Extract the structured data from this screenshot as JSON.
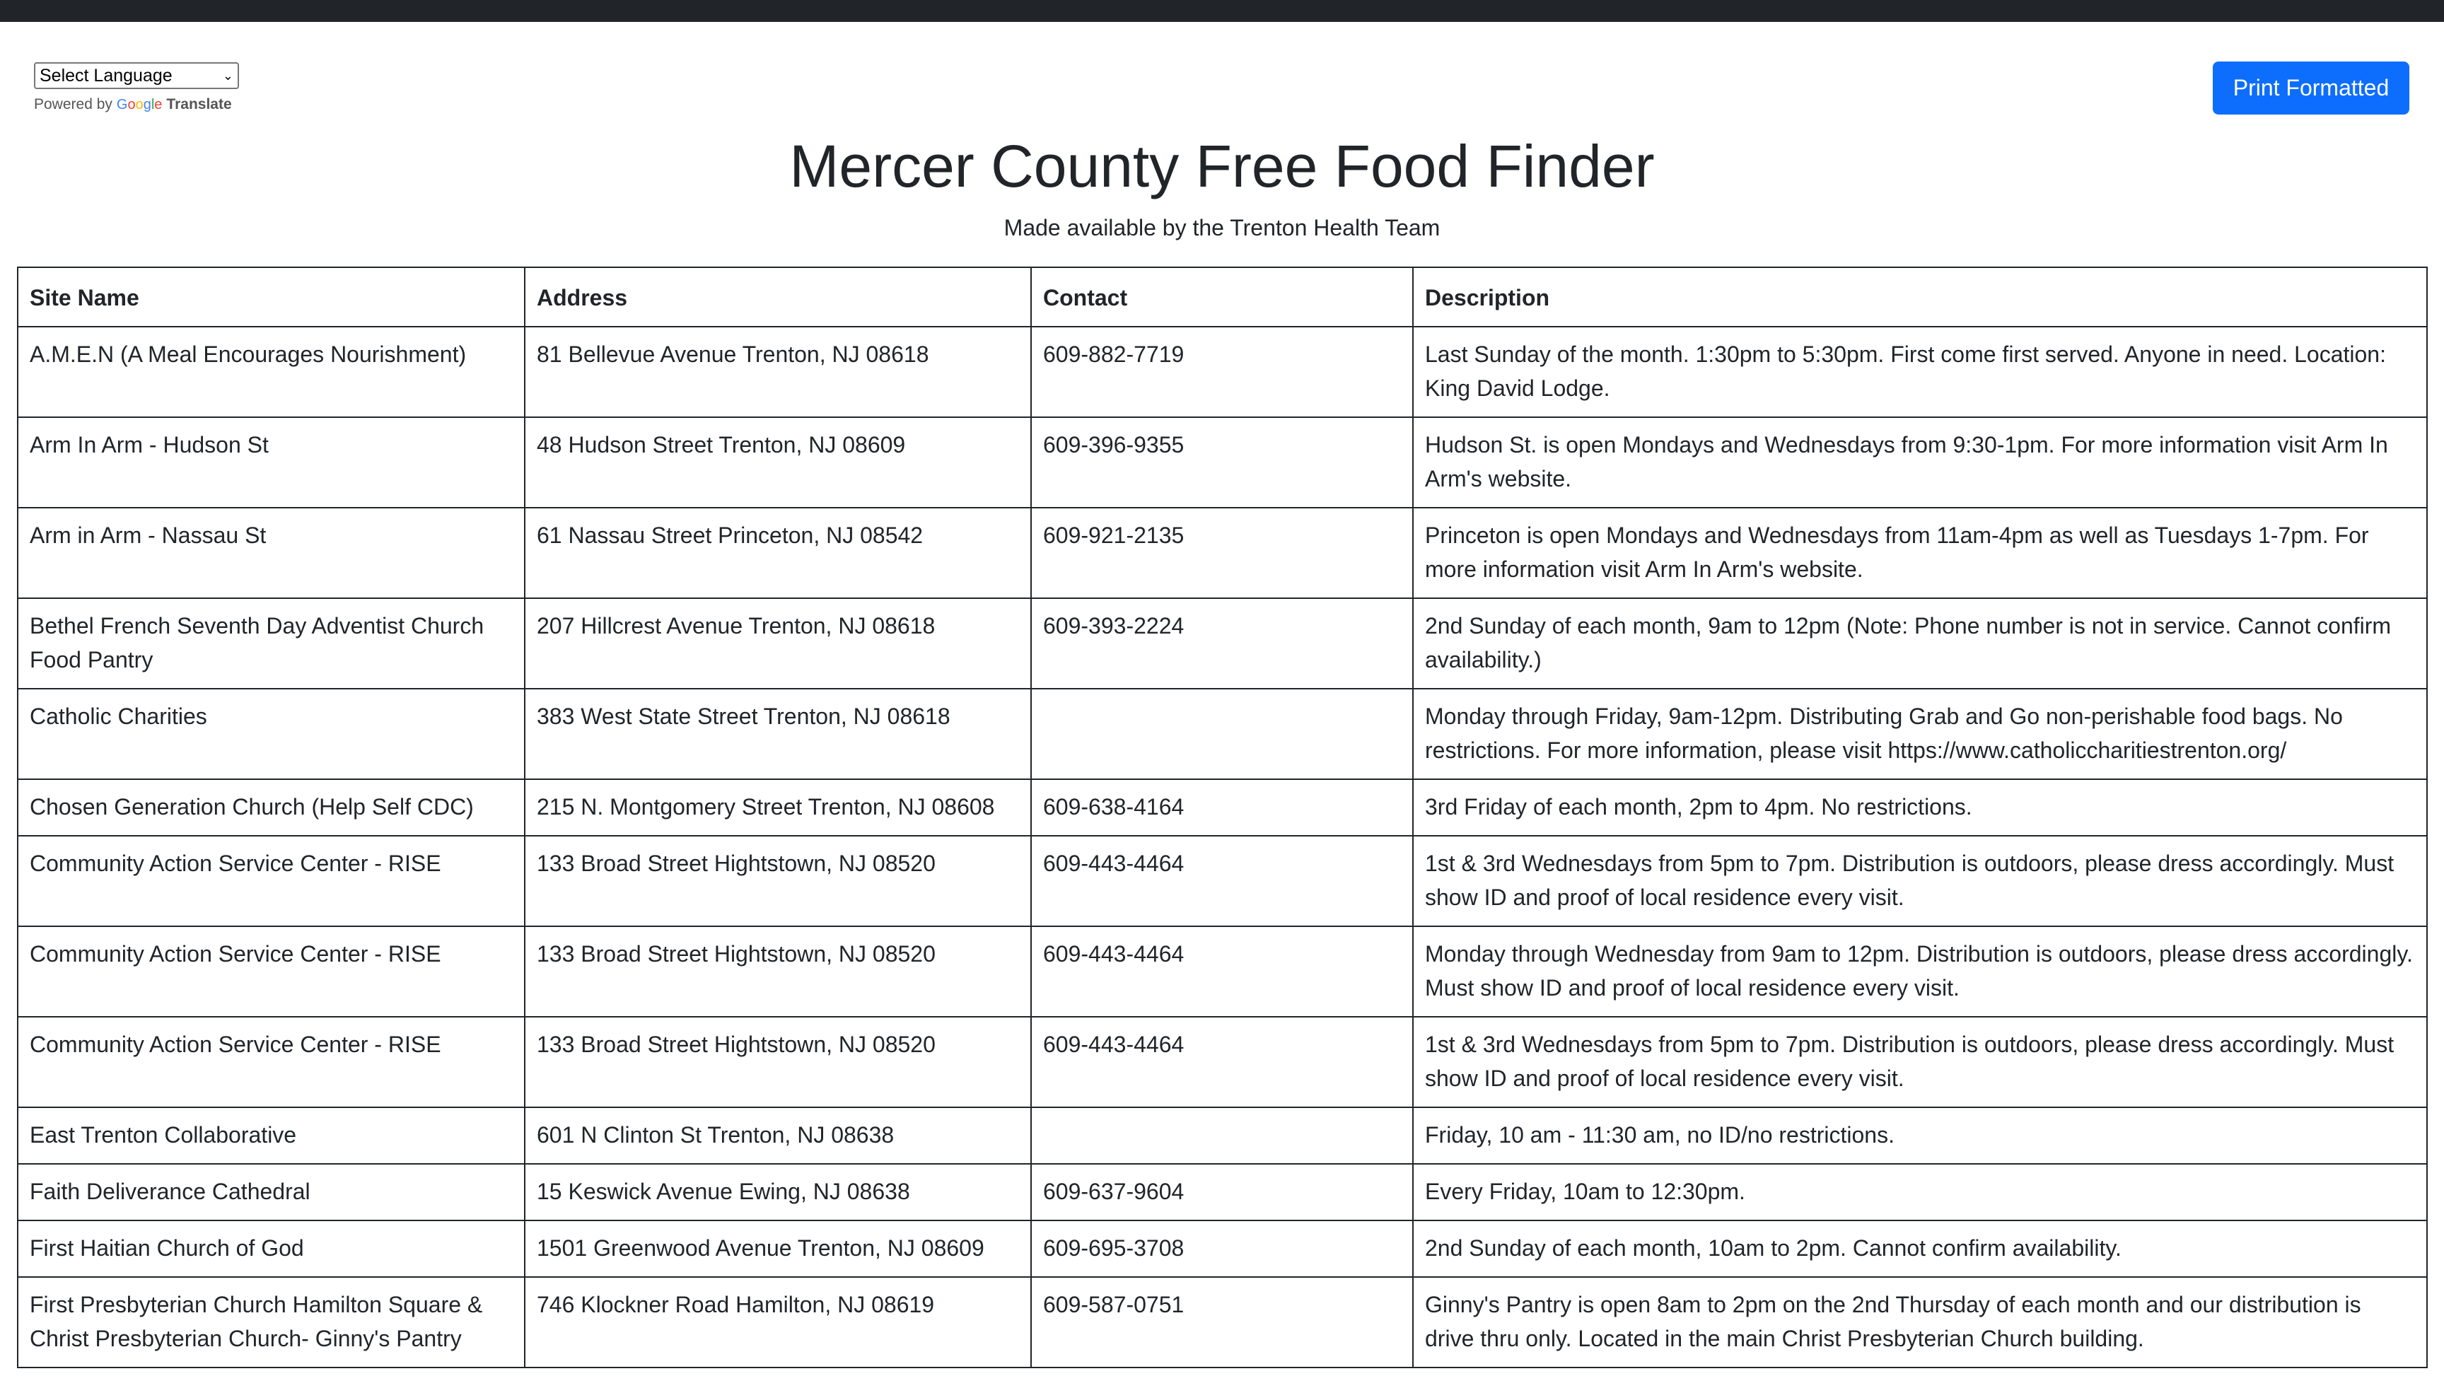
{
  "translate": {
    "select_label": "Select Language",
    "powered_by": "Powered by",
    "google": [
      "G",
      "o",
      "o",
      "g",
      "l",
      "e"
    ],
    "translate_word": "Translate"
  },
  "header": {
    "print_button": "Print Formatted",
    "title": "Mercer County Free Food Finder",
    "subtitle": "Made available by the Trenton Health Team"
  },
  "colors": {
    "topbar": "#212529",
    "primary_button": "#0d6efd"
  },
  "table": {
    "columns": [
      "Site Name",
      "Address",
      "Contact",
      "Description"
    ],
    "rows": [
      [
        "A.M.E.N (A Meal Encourages Nourishment)",
        "81 Bellevue Avenue Trenton, NJ 08618",
        "609-882-7719",
        "Last Sunday of the month. 1:30pm to 5:30pm. First come first served. Anyone in need. Location: King David Lodge."
      ],
      [
        "Arm In Arm - Hudson St",
        "48 Hudson Street Trenton, NJ 08609",
        "609-396-9355",
        "Hudson St. is open Mondays and Wednesdays from 9:30-1pm. For more information visit Arm In Arm's website."
      ],
      [
        "Arm in Arm - Nassau St",
        "61 Nassau Street Princeton, NJ 08542",
        "609-921-2135",
        "Princeton is open Mondays and Wednesdays from 11am-4pm as well as Tuesdays 1-7pm. For more information visit Arm In Arm's website."
      ],
      [
        "Bethel French Seventh Day Adventist Church Food Pantry",
        "207 Hillcrest Avenue Trenton, NJ 08618",
        "609-393-2224",
        "2nd Sunday of each month, 9am to 12pm (Note: Phone number is not in service. Cannot confirm availability.)"
      ],
      [
        "Catholic Charities",
        "383 West State Street Trenton, NJ 08618",
        "",
        "Monday through Friday, 9am-12pm. Distributing Grab and Go non-perishable food bags. No restrictions. For more information, please visit https://www.catholiccharitiestrenton.org/"
      ],
      [
        "Chosen Generation Church (Help Self CDC)",
        "215 N. Montgomery Street Trenton, NJ 08608",
        "609-638-4164",
        "3rd Friday of each month, 2pm to 4pm. No restrictions."
      ],
      [
        "Community Action Service Center - RISE",
        "133 Broad Street Hightstown, NJ 08520",
        "609-443-4464",
        "1st & 3rd Wednesdays from 5pm to 7pm. Distribution is outdoors, please dress accordingly. Must show ID and proof of local residence every visit."
      ],
      [
        "Community Action Service Center - RISE",
        "133 Broad Street Hightstown, NJ 08520",
        "609-443-4464",
        "Monday through Wednesday from 9am to 12pm. Distribution is outdoors, please dress accordingly. Must show ID and proof of local residence every visit."
      ],
      [
        "Community Action Service Center - RISE",
        "133 Broad Street Hightstown, NJ 08520",
        "609-443-4464",
        "1st & 3rd Wednesdays from 5pm to 7pm. Distribution is outdoors, please dress accordingly. Must show ID and proof of local residence every visit."
      ],
      [
        "East Trenton Collaborative",
        "601 N Clinton St Trenton, NJ 08638",
        "",
        "Friday, 10 am - 11:30 am, no ID/no restrictions."
      ],
      [
        "Faith Deliverance Cathedral",
        "15 Keswick Avenue Ewing, NJ 08638",
        "609-637-9604",
        "Every Friday, 10am to 12:30pm."
      ],
      [
        "First Haitian Church of God",
        "1501 Greenwood Avenue Trenton, NJ 08609",
        "609-695-3708",
        "2nd Sunday of each month, 10am to 2pm. Cannot confirm availability."
      ],
      [
        "First Presbyterian Church Hamilton Square & Christ Presbyterian Church- Ginny's Pantry",
        "746 Klockner Road Hamilton, NJ 08619",
        "609-587-0751",
        "Ginny's Pantry is open 8am to 2pm on the 2nd Thursday of each month and our distribution is drive thru only. Located in the main Christ Presbyterian Church building."
      ]
    ]
  }
}
